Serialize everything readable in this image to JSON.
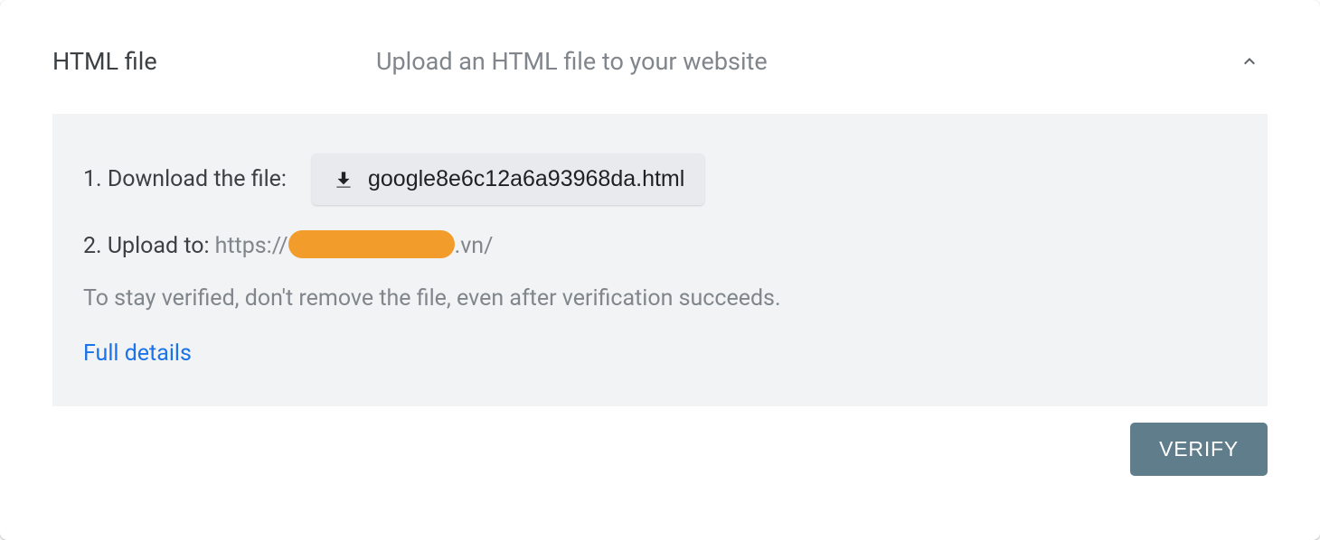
{
  "header": {
    "title": "HTML file",
    "subtitle": "Upload an HTML file to your website"
  },
  "steps": {
    "download_label": "1. Download the file:",
    "download_filename": "google8e6c12a6a93968da.html",
    "upload_label": "2. Upload to: ",
    "upload_url_prefix": "https://",
    "upload_url_suffix": ".vn/"
  },
  "note": "To stay verified, don't remove the file, even after verification succeeds.",
  "full_details_label": "Full details",
  "verify_button_label": "VERIFY"
}
